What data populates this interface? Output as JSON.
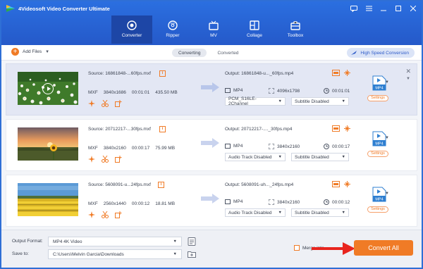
{
  "app": {
    "title": "4Videosoft Video Converter Ultimate"
  },
  "window_controls": [
    "chat-icon",
    "menu-icon",
    "minimize-icon",
    "maximize-icon",
    "close-icon"
  ],
  "tabs": [
    {
      "label": "Converter",
      "icon": "converter-icon",
      "active": true
    },
    {
      "label": "Ripper",
      "icon": "disc-icon",
      "active": false
    },
    {
      "label": "MV",
      "icon": "tv-icon",
      "active": false
    },
    {
      "label": "Collage",
      "icon": "collage-icon",
      "active": false
    },
    {
      "label": "Toolbox",
      "icon": "toolbox-icon",
      "active": false
    }
  ],
  "toolbar": {
    "add_files": "Add Files",
    "segments": [
      "Converting",
      "Converted"
    ],
    "high_speed": "High Speed Conversion"
  },
  "files": [
    {
      "source": "Source: 16861848-...60fps.mxf",
      "format": "MXF",
      "resolution": "3840x1686",
      "duration": "00:01:01",
      "size": "435.50 MB",
      "output": "Output: 16861848-u..._60fps.mp4",
      "out_format": "MP4",
      "out_resolution": "4096x1798",
      "out_duration": "00:01:01",
      "audio": "PCM_S16LE-2Channel",
      "subtitle": "Subtitle Disabled",
      "target_format": "MP4",
      "settings_label": "Settings",
      "selected": true
    },
    {
      "source": "Source: 20712217-...30fps.mxf",
      "format": "MXF",
      "resolution": "3840x2160",
      "duration": "00:00:17",
      "size": "75.99 MB",
      "output": "Output: 20712217-...._30fps.mp4",
      "out_format": "MP4",
      "out_resolution": "3840x2160",
      "out_duration": "00:00:17",
      "audio": "Audio Track Disabled",
      "subtitle": "Subtitle Disabled",
      "target_format": "MP4",
      "settings_label": "Settings",
      "selected": false
    },
    {
      "source": "Source: 5608091-u...24fps.mxf",
      "format": "MXF",
      "resolution": "2560x1440",
      "duration": "00:00:12",
      "size": "18.81 MB",
      "output": "Output: 5608091-uh..._24fps.mp4",
      "out_format": "MP4",
      "out_resolution": "3840x2160",
      "out_duration": "00:00:12",
      "audio": "Audio Track Disabled",
      "subtitle": "Subtitle Disabled",
      "target_format": "MP4",
      "settings_label": "Settings",
      "selected": false
    }
  ],
  "bottom": {
    "output_format_label": "Output Format:",
    "output_format_value": "MP4 4K Video",
    "save_to_label": "Save to:",
    "save_to_value": "C:\\Users\\Melvin Garcia\\Downloads",
    "merge_label": "Merge into",
    "convert_all": "Convert All"
  },
  "colors": {
    "header": "#2559c9",
    "accent": "#f07b26",
    "selected_row": "#e3e7f4"
  }
}
